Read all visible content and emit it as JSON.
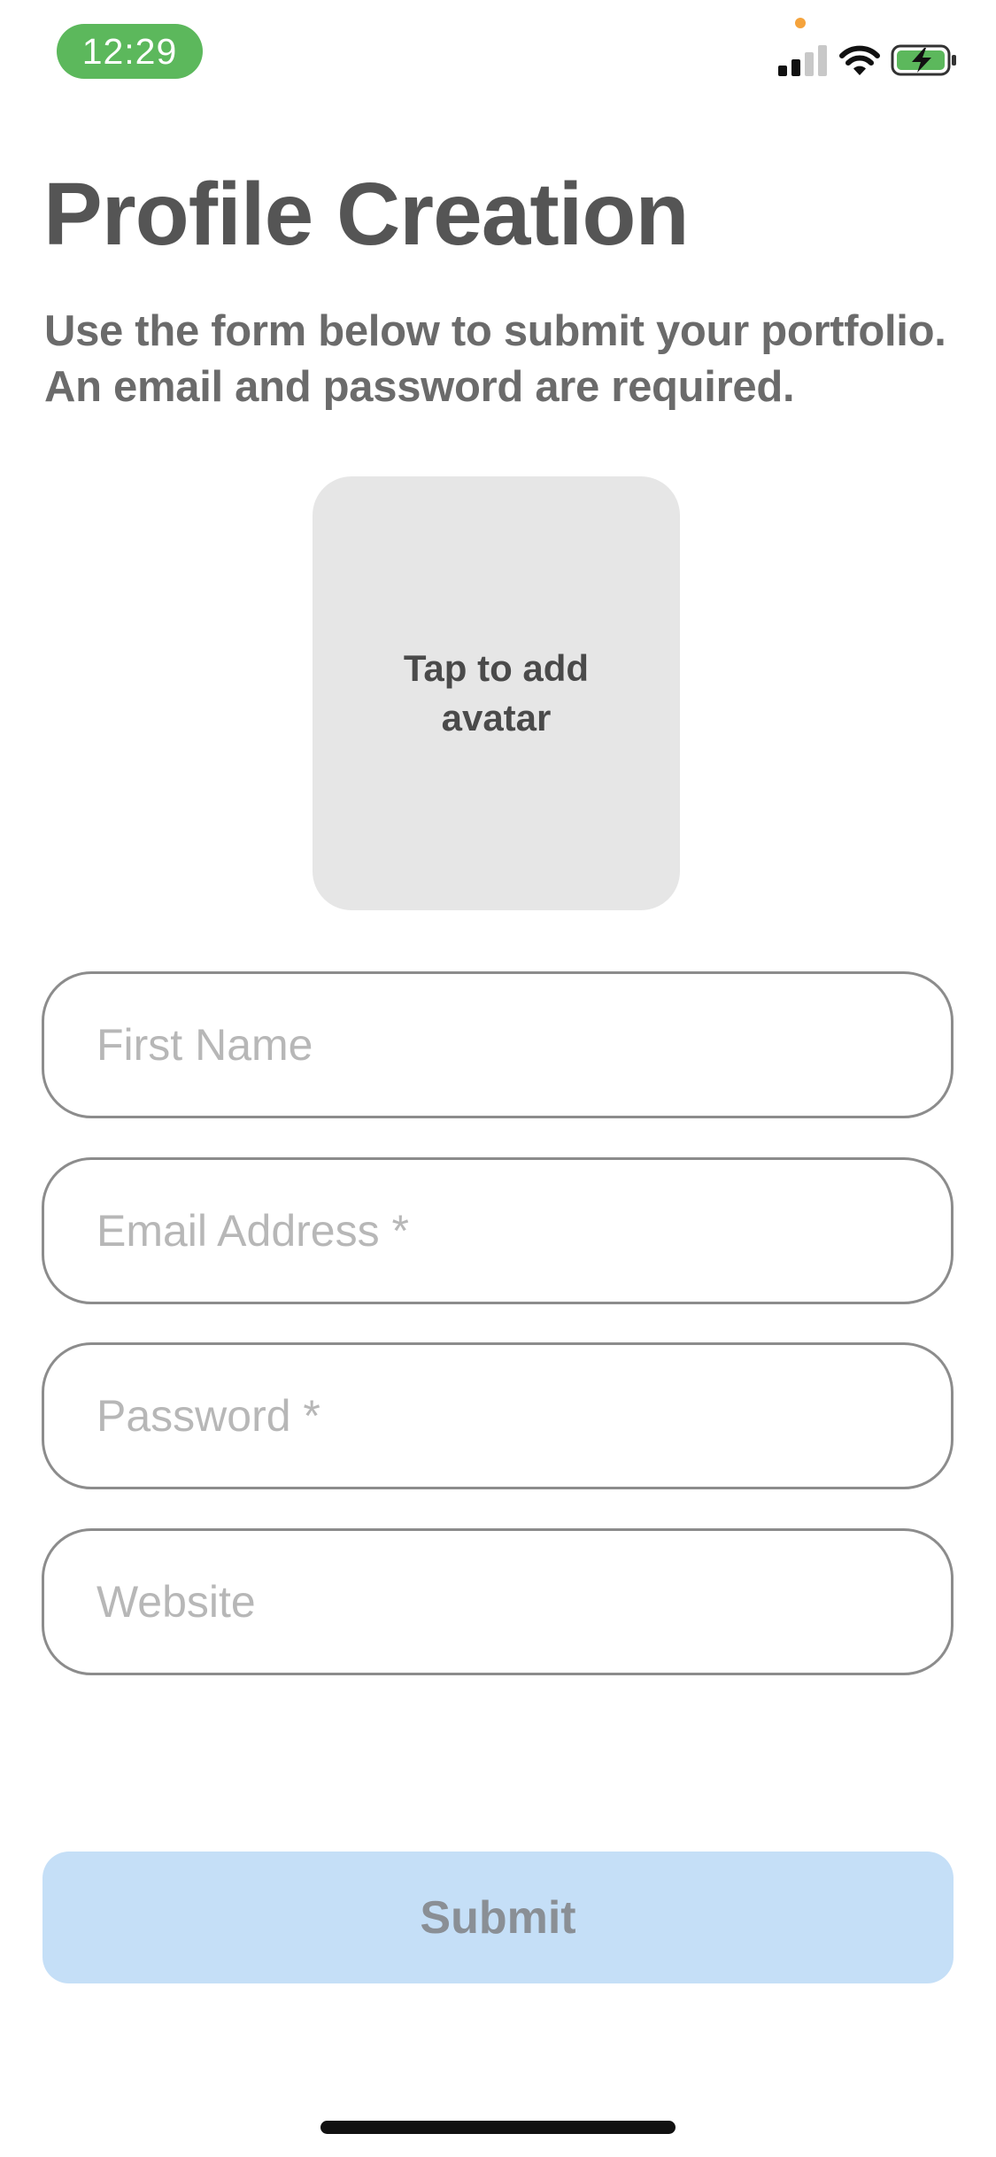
{
  "status_bar": {
    "time": "12:29",
    "icons": [
      "cellular-signal-icon",
      "wifi-icon",
      "battery-charging-icon"
    ],
    "time_pill_color": "#5cb85c",
    "privacy_dot_color": "#f5a33c",
    "battery_color": "#5cb85c"
  },
  "header": {
    "title": "Profile Creation",
    "subtitle_line1": "Use the form below to submit your portfolio.",
    "subtitle_line2": "An email and password are required."
  },
  "avatar": {
    "label": "Tap to add avatar"
  },
  "form": {
    "first_name_placeholder": "First Name",
    "email_placeholder": "Email Address *",
    "password_placeholder": "Password *",
    "website_placeholder": "Website",
    "first_name_value": "",
    "email_value": "",
    "password_value": "",
    "website_value": ""
  },
  "submit": {
    "label": "Submit",
    "background_color": "#c5dff7"
  }
}
